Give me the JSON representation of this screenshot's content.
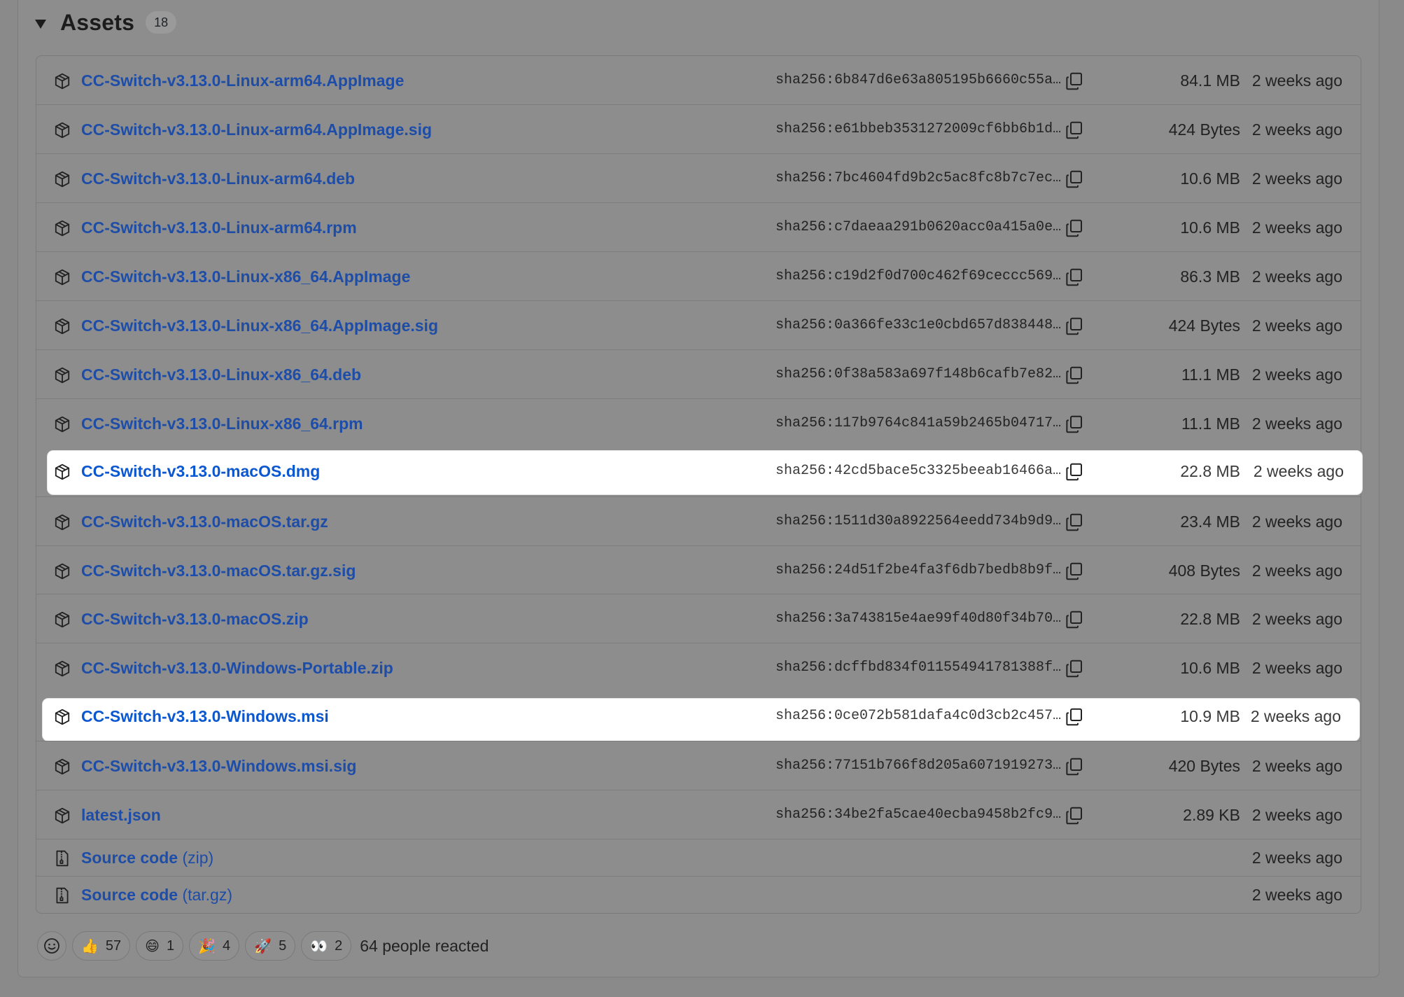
{
  "header": {
    "title": "Assets",
    "count": "18"
  },
  "assets": [
    {
      "name": "CC-Switch-v3.13.0-Linux-arm64.AppImage",
      "sha": "sha256:6b847d6e63a805195b6660c55a…",
      "size": "84.1 MB",
      "date": "2 weeks ago",
      "highlighted": false
    },
    {
      "name": "CC-Switch-v3.13.0-Linux-arm64.AppImage.sig",
      "sha": "sha256:e61bbeb3531272009cf6bb6b1d…",
      "size": "424 Bytes",
      "date": "2 weeks ago",
      "highlighted": false
    },
    {
      "name": "CC-Switch-v3.13.0-Linux-arm64.deb",
      "sha": "sha256:7bc4604fd9b2c5ac8fc8b7c7ec…",
      "size": "10.6 MB",
      "date": "2 weeks ago",
      "highlighted": false
    },
    {
      "name": "CC-Switch-v3.13.0-Linux-arm64.rpm",
      "sha": "sha256:c7daeaa291b0620acc0a415a0e…",
      "size": "10.6 MB",
      "date": "2 weeks ago",
      "highlighted": false
    },
    {
      "name": "CC-Switch-v3.13.0-Linux-x86_64.AppImage",
      "sha": "sha256:c19d2f0d700c462f69ceccc569…",
      "size": "86.3 MB",
      "date": "2 weeks ago",
      "highlighted": false
    },
    {
      "name": "CC-Switch-v3.13.0-Linux-x86_64.AppImage.sig",
      "sha": "sha256:0a366fe33c1e0cbd657d838448…",
      "size": "424 Bytes",
      "date": "2 weeks ago",
      "highlighted": false
    },
    {
      "name": "CC-Switch-v3.13.0-Linux-x86_64.deb",
      "sha": "sha256:0f38a583a697f148b6cafb7e82…",
      "size": "11.1 MB",
      "date": "2 weeks ago",
      "highlighted": false
    },
    {
      "name": "CC-Switch-v3.13.0-Linux-x86_64.rpm",
      "sha": "sha256:117b9764c841a59b2465b04717…",
      "size": "11.1 MB",
      "date": "2 weeks ago",
      "highlighted": false
    },
    {
      "name": "CC-Switch-v3.13.0-macOS.dmg",
      "sha": "sha256:42cd5bace5c3325beeab16466a…",
      "size": "22.8 MB",
      "date": "2 weeks ago",
      "highlighted": true
    },
    {
      "name": "CC-Switch-v3.13.0-macOS.tar.gz",
      "sha": "sha256:1511d30a8922564eedd734b9d9…",
      "size": "23.4 MB",
      "date": "2 weeks ago",
      "highlighted": false
    },
    {
      "name": "CC-Switch-v3.13.0-macOS.tar.gz.sig",
      "sha": "sha256:24d51f2be4fa3f6db7bedb8b9f…",
      "size": "408 Bytes",
      "date": "2 weeks ago",
      "highlighted": false
    },
    {
      "name": "CC-Switch-v3.13.0-macOS.zip",
      "sha": "sha256:3a743815e4ae99f40d80f34b70…",
      "size": "22.8 MB",
      "date": "2 weeks ago",
      "highlighted": false
    },
    {
      "name": "CC-Switch-v3.13.0-Windows-Portable.zip",
      "sha": "sha256:dcffbd834f011554941781388f…",
      "size": "10.6 MB",
      "date": "2 weeks ago",
      "highlighted": false
    },
    {
      "name": "CC-Switch-v3.13.0-Windows.msi",
      "sha": "sha256:0ce072b581dafa4c0d3cb2c457…",
      "size": "10.9 MB",
      "date": "2 weeks ago",
      "highlighted": true
    },
    {
      "name": "CC-Switch-v3.13.0-Windows.msi.sig",
      "sha": "sha256:77151b766f8d205a6071919273…",
      "size": "420 Bytes",
      "date": "2 weeks ago",
      "highlighted": false
    },
    {
      "name": "latest.json",
      "sha": "sha256:34be2fa5cae40ecba9458b2fc9…",
      "size": "2.89 KB",
      "date": "2 weeks ago",
      "highlighted": false
    }
  ],
  "source_code": [
    {
      "label": "Source code",
      "format": "(zip)",
      "date": "2 weeks ago"
    },
    {
      "label": "Source code",
      "format": "(tar.gz)",
      "date": "2 weeks ago"
    }
  ],
  "reactions": {
    "items": [
      {
        "emoji": "👍",
        "icon": "thumbs-up-icon",
        "count": "57"
      },
      {
        "emoji": "😄",
        "icon": "laugh-icon",
        "count": "1"
      },
      {
        "emoji": "🎉",
        "icon": "hooray-icon",
        "count": "4"
      },
      {
        "emoji": "🚀",
        "icon": "rocket-icon",
        "count": "5"
      },
      {
        "emoji": "👀",
        "icon": "eyes-icon",
        "count": "2"
      }
    ],
    "summary": "64 people reacted"
  },
  "colors": {
    "link": "#1e4da8",
    "highlight_bg": "#ffffff",
    "dim_bg": "#8d8d8d"
  }
}
